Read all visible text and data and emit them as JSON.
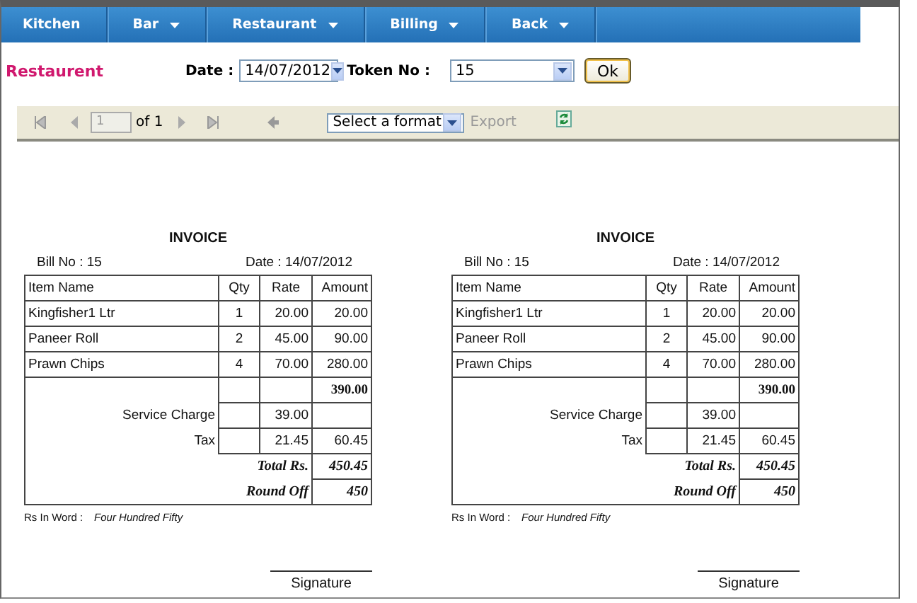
{
  "menu": [
    {
      "label": "Kitchen",
      "has_dropdown": false
    },
    {
      "label": "Bar",
      "has_dropdown": true
    },
    {
      "label": "Restaurant",
      "has_dropdown": true
    },
    {
      "label": "Billing",
      "has_dropdown": true
    },
    {
      "label": "Back",
      "has_dropdown": true
    }
  ],
  "page_title": "Restaurent",
  "filters": {
    "date_label": "Date :",
    "date_value": "14/07/2012",
    "token_label": "Token No :",
    "token_value": "15",
    "ok_button": "Ok"
  },
  "report_toolbar": {
    "page_value": "1",
    "page_of": "of 1",
    "format_placeholder": "Select a format",
    "export_label": "Export",
    "export_disabled": true
  },
  "invoices": [
    {
      "title": "INVOICE",
      "bill_no": "Bill No : 15",
      "date": "Date : 14/07/2012",
      "columns": [
        "Item Name",
        "Qty",
        "Rate",
        "Amount"
      ],
      "items": [
        {
          "name": "Kingfisher1 Ltr",
          "qty": "1",
          "rate": "20.00",
          "amount": "20.00"
        },
        {
          "name": "Paneer Roll",
          "qty": "2",
          "rate": "45.00",
          "amount": "90.00"
        },
        {
          "name": "Prawn Chips",
          "qty": "4",
          "rate": "70.00",
          "amount": "280.00"
        }
      ],
      "subtotal": "390.00",
      "service_charge_label": "Service Charge",
      "service_charge_rate": "39.00",
      "tax_label": "Tax",
      "tax_rate": "21.45",
      "tax_amount": "60.45",
      "total_label": "Total Rs.",
      "total": "450.45",
      "round_off_label": "Round Off",
      "round_off": "450",
      "in_words_label": "Rs In Word :",
      "in_words": "Four Hundred Fifty",
      "signature": "Signature"
    },
    {
      "title": "INVOICE",
      "bill_no": "Bill No : 15",
      "date": "Date : 14/07/2012",
      "columns": [
        "Item Name",
        "Qty",
        "Rate",
        "Amount"
      ],
      "items": [
        {
          "name": "Kingfisher1 Ltr",
          "qty": "1",
          "rate": "20.00",
          "amount": "20.00"
        },
        {
          "name": "Paneer Roll",
          "qty": "2",
          "rate": "45.00",
          "amount": "90.00"
        },
        {
          "name": "Prawn Chips",
          "qty": "4",
          "rate": "70.00",
          "amount": "280.00"
        }
      ],
      "subtotal": "390.00",
      "service_charge_label": "Service Charge",
      "service_charge_rate": "39.00",
      "tax_label": "Tax",
      "tax_rate": "21.45",
      "tax_amount": "60.45",
      "total_label": "Total Rs.",
      "total": "450.45",
      "round_off_label": "Round Off",
      "round_off": "450",
      "in_words_label": "Rs In Word :",
      "in_words": "Four Hundred Fifty",
      "signature": "Signature"
    }
  ]
}
